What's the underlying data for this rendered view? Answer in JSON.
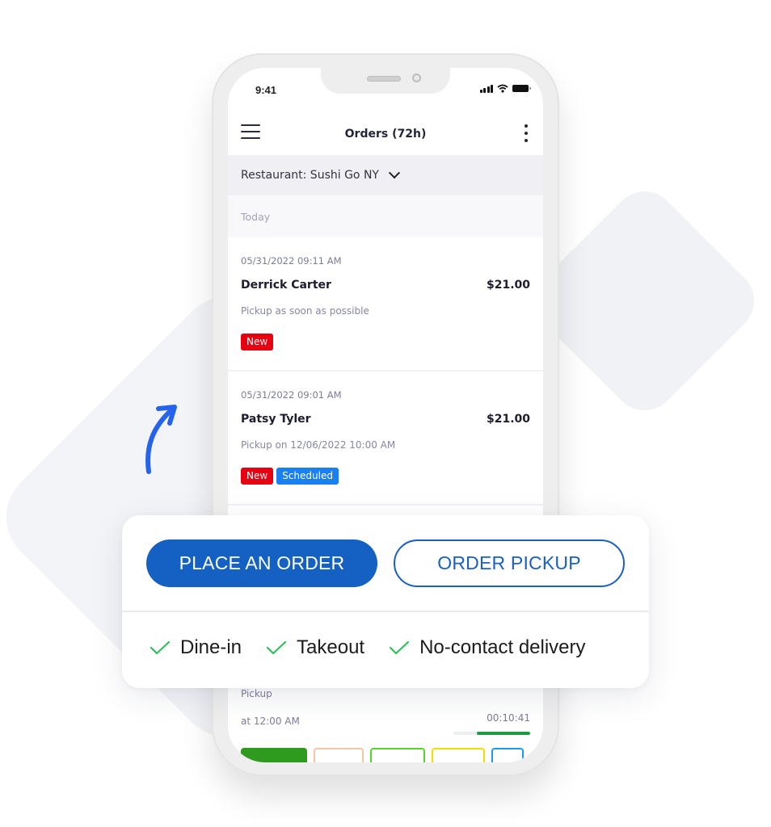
{
  "status_bar": {
    "time": "9:41"
  },
  "app_bar": {
    "title": "Orders (72h)"
  },
  "restaurant_selector": {
    "label": "Restaurant: Sushi Go NY"
  },
  "section": {
    "label": "Today"
  },
  "orders": [
    {
      "datetime": "05/31/2022 09:11 AM",
      "customer": "Derrick Carter",
      "price": "$21.00",
      "description": "Pickup as soon as possible",
      "badges": [
        {
          "label": "New",
          "color": "#e60012"
        }
      ]
    },
    {
      "datetime": "05/31/2022 09:01 AM",
      "customer": "Patsy Tyler",
      "price": "$21.00",
      "description": "Pickup on 12/06/2022 10:00 AM",
      "badges": [
        {
          "label": "New",
          "color": "#e60012"
        },
        {
          "label": "Scheduled",
          "color": "#1a7ff0"
        }
      ]
    },
    {
      "pickup_label": "Pickup",
      "pickup_time": "at 12:00 AM",
      "timer": "00:10:41",
      "progress": 0.7,
      "status_tag_colors": [
        "#2e9b1f",
        "#f8c4a4",
        "#55d42a",
        "#f0df00",
        "#1a9bf0"
      ]
    }
  ],
  "actions": {
    "primary_label": "PLACE AN ORDER",
    "secondary_label": "ORDER PICKUP"
  },
  "features": [
    {
      "label": "Dine-in"
    },
    {
      "label": "Takeout"
    },
    {
      "label": "No-contact delivery"
    }
  ],
  "colors": {
    "brand_blue": "#1460c3",
    "check_green": "#2fbf5a",
    "arrow_blue": "#2563eb"
  }
}
